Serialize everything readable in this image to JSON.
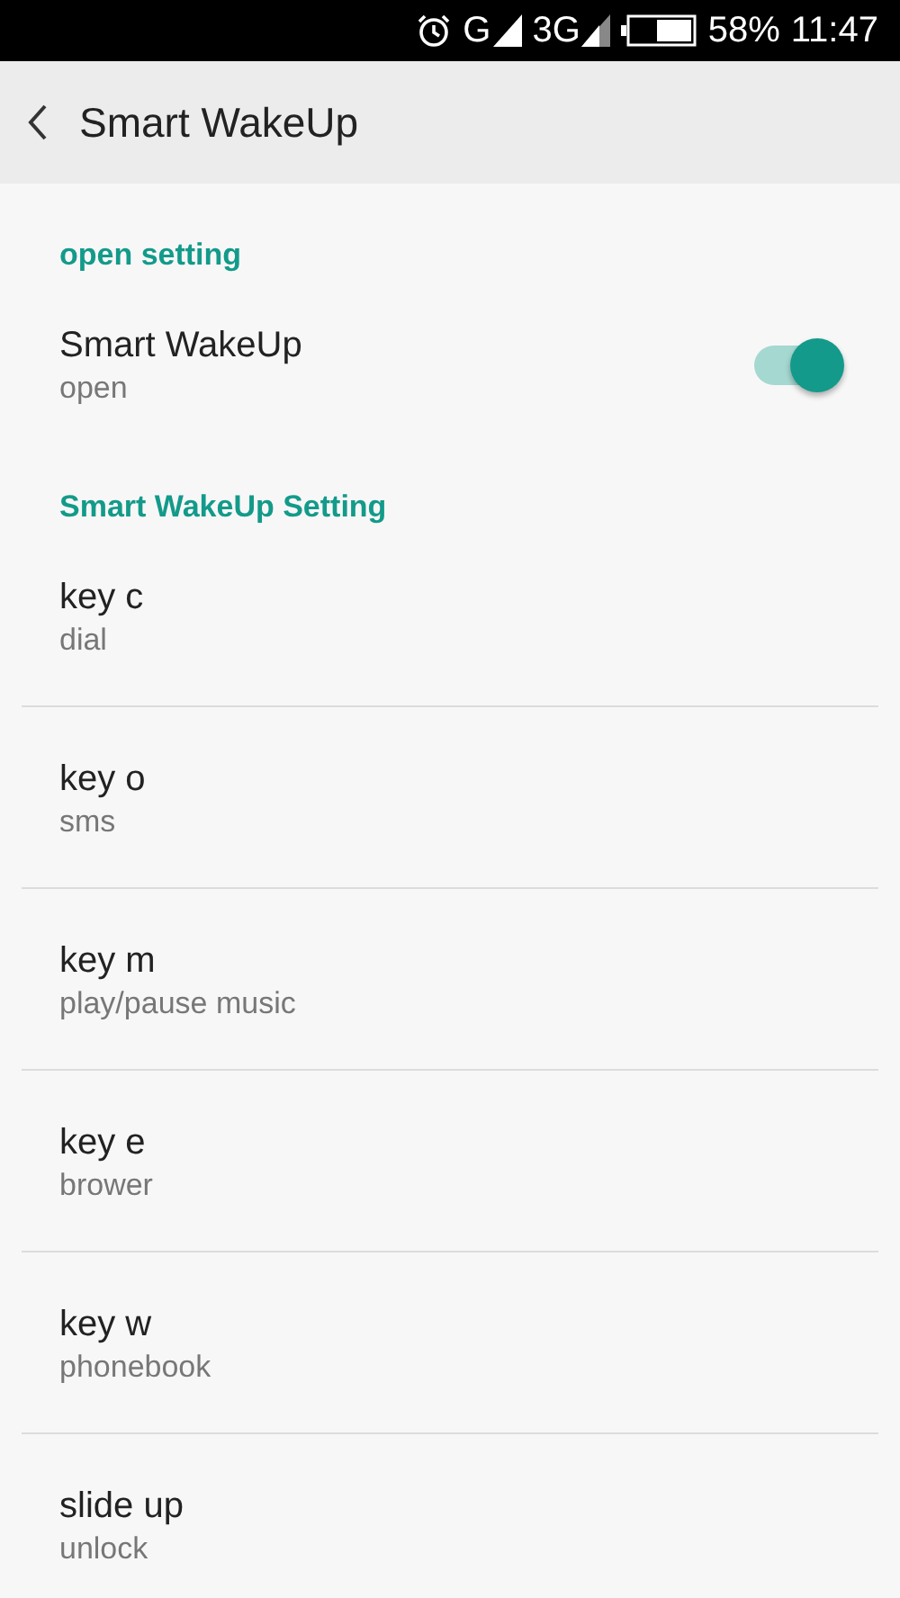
{
  "status_bar": {
    "network_primary": "G",
    "network_secondary": "3G",
    "battery": "58%",
    "time": "11:47"
  },
  "header": {
    "title": "Smart WakeUp"
  },
  "sections": [
    {
      "title": "open setting",
      "items": [
        {
          "kind": "switch",
          "title": "Smart WakeUp",
          "subtitle": "open",
          "on": true
        }
      ]
    },
    {
      "title": "Smart WakeUp Setting",
      "items": [
        {
          "kind": "action",
          "title": "key c",
          "subtitle": "dial"
        },
        {
          "kind": "action",
          "title": "key o",
          "subtitle": "sms"
        },
        {
          "kind": "action",
          "title": "key m",
          "subtitle": "play/pause music"
        },
        {
          "kind": "action",
          "title": "key e",
          "subtitle": "brower"
        },
        {
          "kind": "action",
          "title": "key w",
          "subtitle": "phonebook"
        },
        {
          "kind": "action",
          "title": "slide up",
          "subtitle": "unlock"
        }
      ]
    }
  ]
}
